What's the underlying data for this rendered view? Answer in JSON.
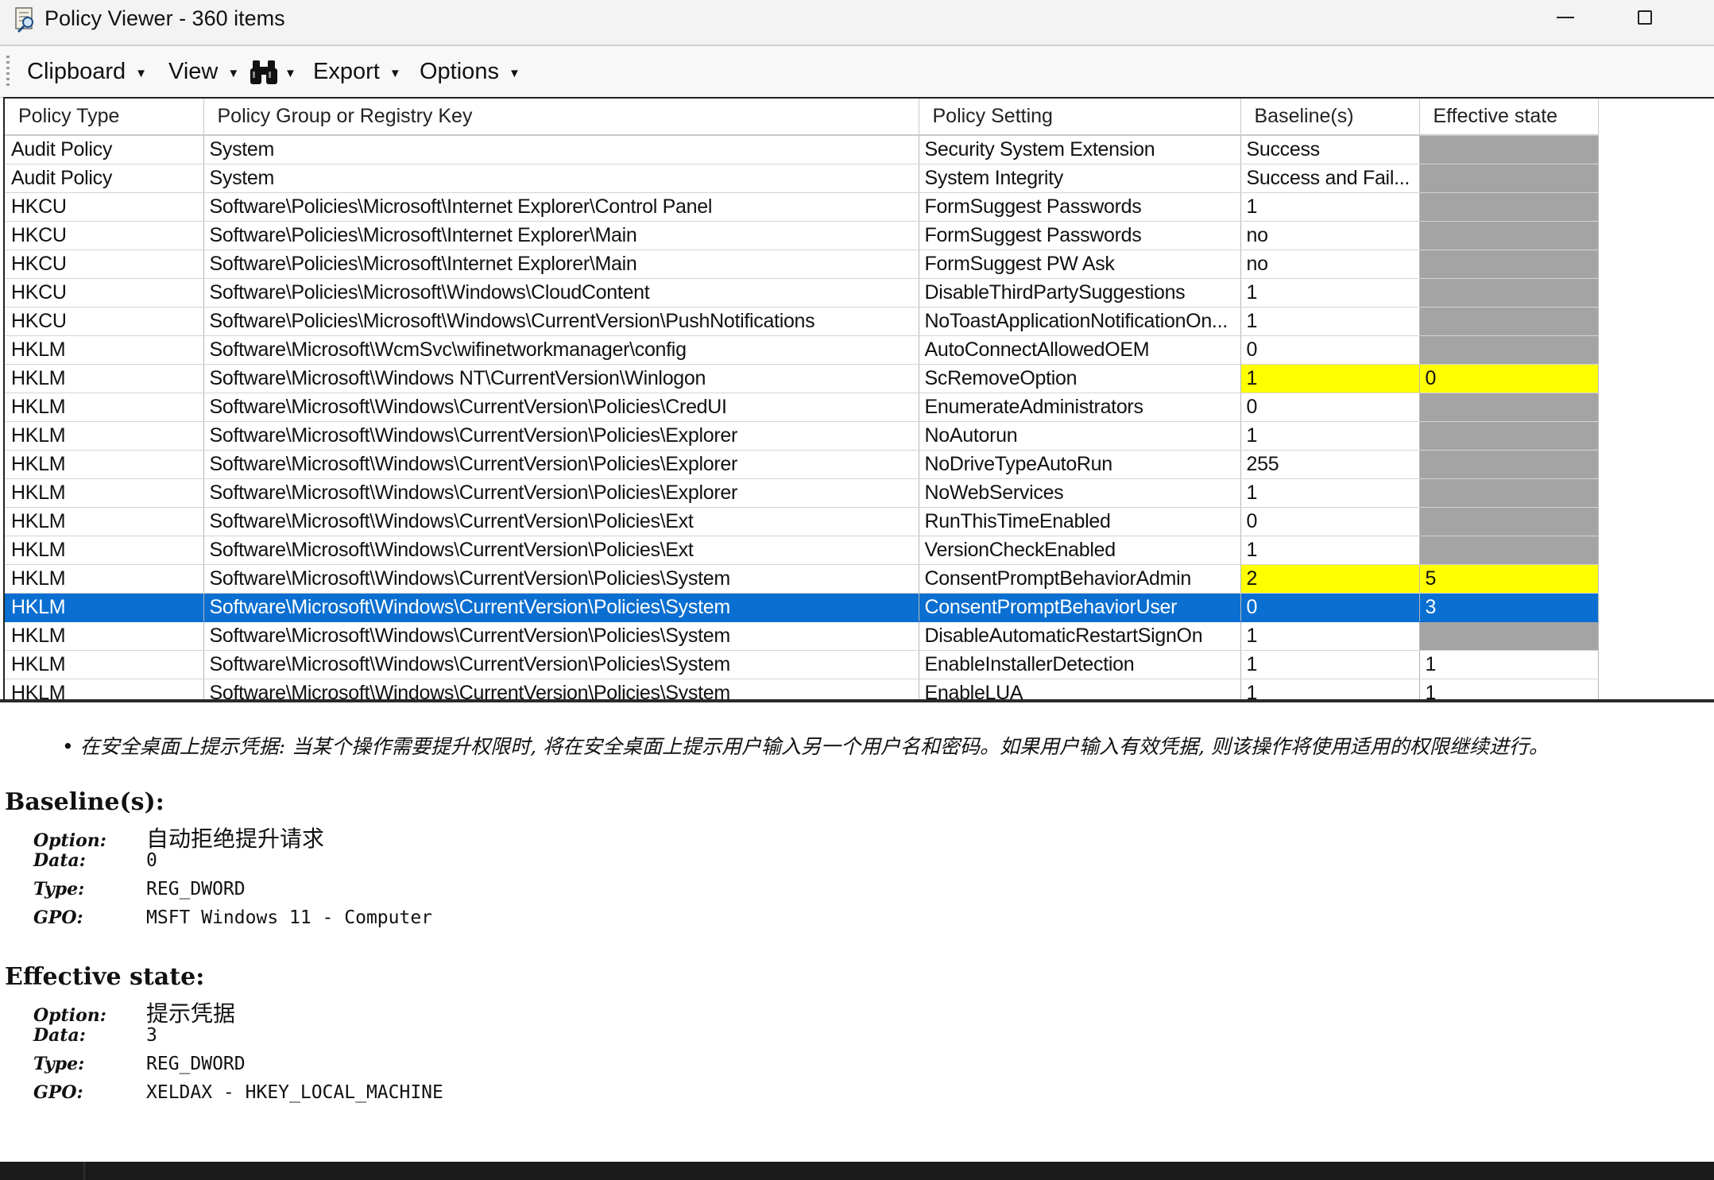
{
  "window": {
    "title": "Policy Viewer - 360 items"
  },
  "toolbar": {
    "clipboard": "Clipboard",
    "view": "View",
    "export": "Export",
    "options": "Options",
    "find_icon": "binoculars-icon"
  },
  "table": {
    "columns": [
      "Policy Type",
      "Policy Group or Registry Key",
      "Policy Setting",
      "Baseline(s)",
      "Effective state"
    ],
    "rows": [
      {
        "type": "Audit Policy",
        "key": "System",
        "setting": "Security System Extension",
        "baseline": "Success",
        "effective": "",
        "state": "none"
      },
      {
        "type": "Audit Policy",
        "key": "System",
        "setting": "System Integrity",
        "baseline": "Success and Fail...",
        "effective": "",
        "state": "none"
      },
      {
        "type": "HKCU",
        "key": "Software\\Policies\\Microsoft\\Internet Explorer\\Control Panel",
        "setting": "FormSuggest Passwords",
        "baseline": "1",
        "effective": "",
        "state": "none"
      },
      {
        "type": "HKCU",
        "key": "Software\\Policies\\Microsoft\\Internet Explorer\\Main",
        "setting": "FormSuggest Passwords",
        "baseline": "no",
        "effective": "",
        "state": "none"
      },
      {
        "type": "HKCU",
        "key": "Software\\Policies\\Microsoft\\Internet Explorer\\Main",
        "setting": "FormSuggest PW Ask",
        "baseline": "no",
        "effective": "",
        "state": "none"
      },
      {
        "type": "HKCU",
        "key": "Software\\Policies\\Microsoft\\Windows\\CloudContent",
        "setting": "DisableThirdPartySuggestions",
        "baseline": "1",
        "effective": "",
        "state": "none"
      },
      {
        "type": "HKCU",
        "key": "Software\\Policies\\Microsoft\\Windows\\CurrentVersion\\PushNotifications",
        "setting": "NoToastApplicationNotificationOn...",
        "baseline": "1",
        "effective": "",
        "state": "none"
      },
      {
        "type": "HKLM",
        "key": "Software\\Microsoft\\WcmSvc\\wifinetworkmanager\\config",
        "setting": "AutoConnectAllowedOEM",
        "baseline": "0",
        "effective": "",
        "state": "none"
      },
      {
        "type": "HKLM",
        "key": "Software\\Microsoft\\Windows NT\\CurrentVersion\\Winlogon",
        "setting": "ScRemoveOption",
        "baseline": "1",
        "effective": "0",
        "state": "diff"
      },
      {
        "type": "HKLM",
        "key": "Software\\Microsoft\\Windows\\CurrentVersion\\Policies\\CredUI",
        "setting": "EnumerateAdministrators",
        "baseline": "0",
        "effective": "",
        "state": "none"
      },
      {
        "type": "HKLM",
        "key": "Software\\Microsoft\\Windows\\CurrentVersion\\Policies\\Explorer",
        "setting": "NoAutorun",
        "baseline": "1",
        "effective": "",
        "state": "none"
      },
      {
        "type": "HKLM",
        "key": "Software\\Microsoft\\Windows\\CurrentVersion\\Policies\\Explorer",
        "setting": "NoDriveTypeAutoRun",
        "baseline": "255",
        "effective": "",
        "state": "none"
      },
      {
        "type": "HKLM",
        "key": "Software\\Microsoft\\Windows\\CurrentVersion\\Policies\\Explorer",
        "setting": "NoWebServices",
        "baseline": "1",
        "effective": "",
        "state": "none"
      },
      {
        "type": "HKLM",
        "key": "Software\\Microsoft\\Windows\\CurrentVersion\\Policies\\Ext",
        "setting": "RunThisTimeEnabled",
        "baseline": "0",
        "effective": "",
        "state": "none"
      },
      {
        "type": "HKLM",
        "key": "Software\\Microsoft\\Windows\\CurrentVersion\\Policies\\Ext",
        "setting": "VersionCheckEnabled",
        "baseline": "1",
        "effective": "",
        "state": "none"
      },
      {
        "type": "HKLM",
        "key": "Software\\Microsoft\\Windows\\CurrentVersion\\Policies\\System",
        "setting": "ConsentPromptBehaviorAdmin",
        "baseline": "2",
        "effective": "5",
        "state": "diff"
      },
      {
        "type": "HKLM",
        "key": "Software\\Microsoft\\Windows\\CurrentVersion\\Policies\\System",
        "setting": "ConsentPromptBehaviorUser",
        "baseline": "0",
        "effective": "3",
        "state": "selected"
      },
      {
        "type": "HKLM",
        "key": "Software\\Microsoft\\Windows\\CurrentVersion\\Policies\\System",
        "setting": "DisableAutomaticRestartSignOn",
        "baseline": "1",
        "effective": "",
        "state": "none"
      },
      {
        "type": "HKLM",
        "key": "Software\\Microsoft\\Windows\\CurrentVersion\\Policies\\System",
        "setting": "EnableInstallerDetection",
        "baseline": "1",
        "effective": "1",
        "state": "match"
      },
      {
        "type": "HKLM",
        "key": "Software\\Microsoft\\Windows\\CurrentVersion\\Policies\\System",
        "setting": "EnableLUA",
        "baseline": "1",
        "effective": "1",
        "state": "match"
      }
    ]
  },
  "details": {
    "description": "• 在安全桌面上提示凭据: 当某个操作需要提升权限时, 将在安全桌面上提示用户输入另一个用户名和密码。如果用户输入有效凭据, 则该操作将使用适用的权限继续进行。",
    "baseline_heading": "Baseline(s):",
    "baseline": [
      {
        "k": "Option:",
        "v": "自动拒绝提升请求"
      },
      {
        "k": "Data:",
        "v": "0"
      },
      {
        "k": "Type:",
        "v": "REG_DWORD"
      },
      {
        "k": "GPO:",
        "v": "MSFT Windows 11 - Computer"
      }
    ],
    "effective_heading": "Effective state:",
    "effective": [
      {
        "k": "Option:",
        "v": "提示凭据"
      },
      {
        "k": "Data:",
        "v": "3"
      },
      {
        "k": "Type:",
        "v": "REG_DWORD"
      },
      {
        "k": "GPO:",
        "v": "XELDAX - HKEY_LOCAL_MACHINE"
      }
    ]
  },
  "colors": {
    "selected_row": "#0a6fd1",
    "diff_highlight": "#ffff00",
    "no_effective_state": "#a4a4a4"
  }
}
